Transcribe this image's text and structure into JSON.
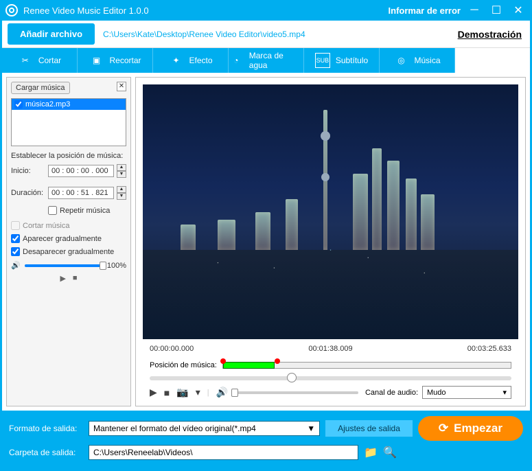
{
  "titlebar": {
    "title": "Renee Video Music Editor 1.0.0",
    "report": "Informar de error"
  },
  "topbar": {
    "add_file": "Añadir archivo",
    "path": "C:\\Users\\Kate\\Desktop\\Renee Video Editor\\video5.mp4",
    "demo": "Demostración"
  },
  "tools": {
    "cut": "Cortar",
    "crop": "Recortar",
    "effect": "Efecto",
    "watermark": "Marca de agua",
    "subtitle": "Subtítulo",
    "music": "Música"
  },
  "left": {
    "load_music": "Cargar música",
    "music_item": "música2.mp3",
    "set_pos_label": "Establecer la posición de música:",
    "start_label": "Inicio:",
    "start_val": "00 : 00 : 00 . 000",
    "duration_label": "Duración:",
    "duration_val": "00 : 00 : 51 . 821",
    "repeat": "Repetir música",
    "cut_music": "Cortar música",
    "fade_in": "Aparecer gradualmente",
    "fade_out": "Desaparecer gradualmente",
    "volume": "100%"
  },
  "preview": {
    "t0": "00:00:00.000",
    "t1": "00:01:38.009",
    "t2": "00:03:25.633",
    "track_label": "Posición de música:",
    "audio_label": "Canal de audio:",
    "audio_value": "Mudo"
  },
  "bottom": {
    "format_label": "Formato de salida:",
    "format_value": "Mantener el formato del vídeo original(*.mp4",
    "settings": "Ajustes de salida",
    "folder_label": "Carpeta de salida:",
    "folder_value": "C:\\Users\\Reneelab\\Videos\\",
    "start": "Empezar"
  }
}
